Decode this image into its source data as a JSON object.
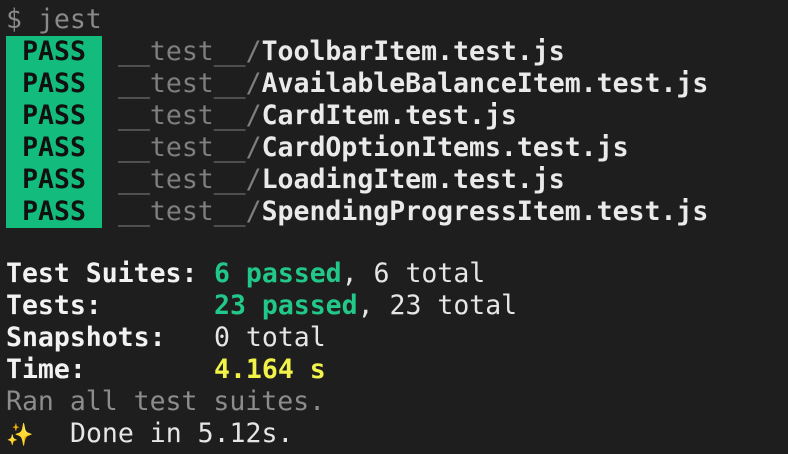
{
  "command": {
    "prompt": "$",
    "text": "jest"
  },
  "results": [
    {
      "status": "PASS",
      "dir": "__test__/",
      "file": "ToolbarItem.test.js"
    },
    {
      "status": "PASS",
      "dir": "__test__/",
      "file": "AvailableBalanceItem.test.js"
    },
    {
      "status": "PASS",
      "dir": "__test__/",
      "file": "CardItem.test.js"
    },
    {
      "status": "PASS",
      "dir": "__test__/",
      "file": "CardOptionItems.test.js"
    },
    {
      "status": "PASS",
      "dir": "__test__/",
      "file": "LoadingItem.test.js"
    },
    {
      "status": "PASS",
      "dir": "__test__/",
      "file": "SpendingProgressItem.test.js"
    }
  ],
  "summary": {
    "suites": {
      "label": "Test Suites:",
      "passed": "6 passed",
      "rest": ", 6 total"
    },
    "tests": {
      "label": "Tests:",
      "passed": "23 passed",
      "rest": ", 23 total"
    },
    "snapshots": {
      "label": "Snapshots:",
      "value": "0 total"
    },
    "time": {
      "label": "Time:",
      "value": "4.164 s"
    }
  },
  "footer": {
    "ran": "Ran all test suites.",
    "sparkle": "✨",
    "done": "Done in 5.12s."
  },
  "colors": {
    "background": "#1e1e1e",
    "pass_badge": "#13bc7d",
    "passed_text": "#22c88a",
    "time_text": "#f1f24a",
    "dim_text": "#8c8c8c"
  }
}
